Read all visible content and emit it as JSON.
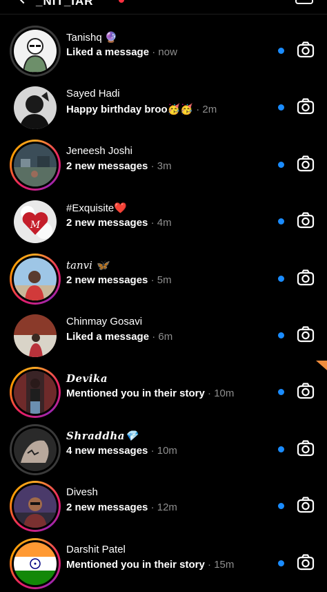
{
  "header": {
    "username": "_NIT_IAR",
    "notification_color": "#ff3040"
  },
  "conversations": [
    {
      "name": "Tanishq 🔮",
      "message": "Liked a message",
      "time": "· now",
      "ring": "seen",
      "unread": true
    },
    {
      "name": "Sayed Hadi",
      "message": "Happy birthday broo🥳🥳",
      "time": "· 2m",
      "ring": "none",
      "unread": true
    },
    {
      "name": "Jeneesh Joshi",
      "message": "2 new messages",
      "time": "· 3m",
      "ring": "story",
      "unread": true
    },
    {
      "name": "#Exquisite❤️",
      "message": "2 new messages",
      "time": "· 4m",
      "ring": "none",
      "unread": true
    },
    {
      "name": "tanvi 🦋",
      "message": "2 new messages",
      "time": "· 5m",
      "ring": "story",
      "unread": true
    },
    {
      "name": "Chinmay Gosavi",
      "message": "Liked a message",
      "time": "· 6m",
      "ring": "none",
      "unread": true
    },
    {
      "name": "Devika",
      "message": "Mentioned you in their story",
      "time": "· 10m",
      "ring": "story",
      "unread": true
    },
    {
      "name": "Shraddha💎",
      "message": "4 new messages",
      "time": "· 10m",
      "ring": "seen",
      "unread": true
    },
    {
      "name": "Divesh",
      "message": "2 new messages",
      "time": "· 12m",
      "ring": "story",
      "unread": true
    },
    {
      "name": "Darshit Patel",
      "message": "Mentioned you in their story",
      "time": "· 15m",
      "ring": "story",
      "unread": true
    }
  ],
  "colors": {
    "unread_dot": "#1a8cff",
    "secondary_text": "#8e8e8e",
    "corner_badge": "#f08c3c"
  }
}
